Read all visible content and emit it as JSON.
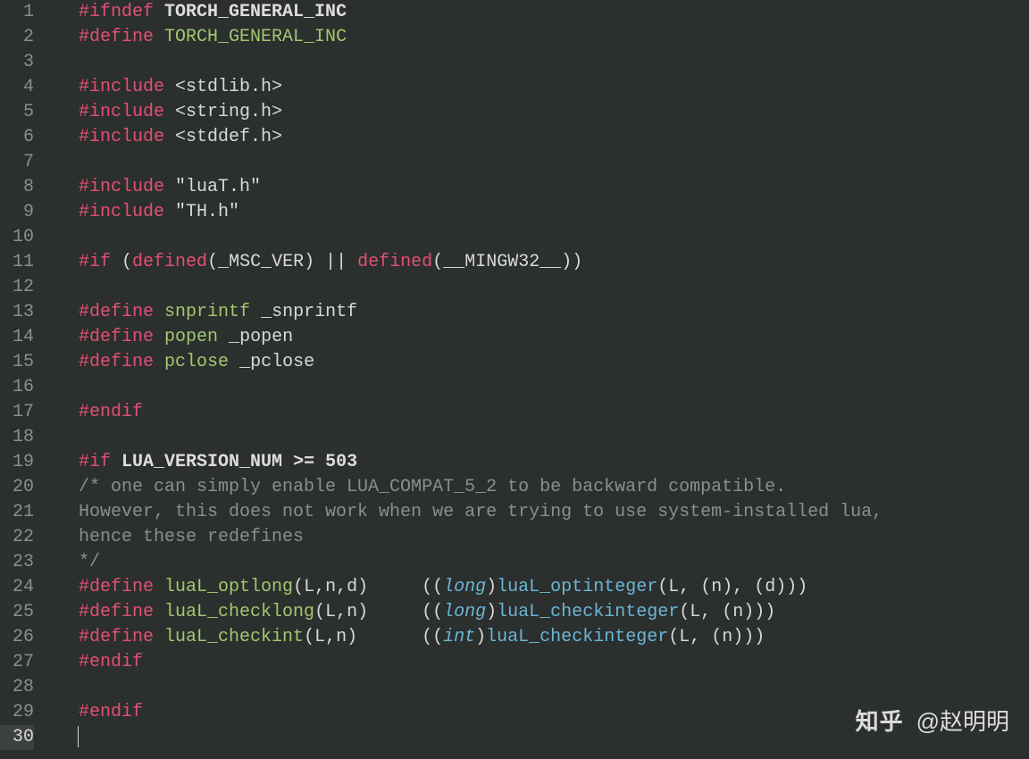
{
  "total_lines": 30,
  "active_line": 30,
  "watermark": {
    "site": "知乎",
    "author": "@赵明明"
  },
  "code_lines": [
    {
      "n": 1,
      "segments": [
        {
          "cls": "c-directive",
          "t": "#ifndef"
        },
        {
          "cls": "c-text",
          "t": " "
        },
        {
          "cls": "c-macro",
          "t": "TORCH_GENERAL_INC"
        }
      ]
    },
    {
      "n": 2,
      "segments": [
        {
          "cls": "c-directive",
          "t": "#define"
        },
        {
          "cls": "c-text",
          "t": " "
        },
        {
          "cls": "c-ident",
          "t": "TORCH_GENERAL_INC"
        }
      ]
    },
    {
      "n": 3,
      "segments": []
    },
    {
      "n": 4,
      "segments": [
        {
          "cls": "c-directive",
          "t": "#include"
        },
        {
          "cls": "c-text",
          "t": " "
        },
        {
          "cls": "c-string",
          "t": "<stdlib.h>"
        }
      ]
    },
    {
      "n": 5,
      "segments": [
        {
          "cls": "c-directive",
          "t": "#include"
        },
        {
          "cls": "c-text",
          "t": " "
        },
        {
          "cls": "c-string",
          "t": "<string.h>"
        }
      ]
    },
    {
      "n": 6,
      "segments": [
        {
          "cls": "c-directive",
          "t": "#include"
        },
        {
          "cls": "c-text",
          "t": " "
        },
        {
          "cls": "c-string",
          "t": "<stddef.h>"
        }
      ]
    },
    {
      "n": 7,
      "segments": []
    },
    {
      "n": 8,
      "segments": [
        {
          "cls": "c-directive",
          "t": "#include"
        },
        {
          "cls": "c-text",
          "t": " "
        },
        {
          "cls": "c-string",
          "t": "\"luaT.h\""
        }
      ]
    },
    {
      "n": 9,
      "segments": [
        {
          "cls": "c-directive",
          "t": "#include"
        },
        {
          "cls": "c-text",
          "t": " "
        },
        {
          "cls": "c-string",
          "t": "\"TH.h\""
        }
      ]
    },
    {
      "n": 10,
      "segments": []
    },
    {
      "n": 11,
      "segments": [
        {
          "cls": "c-directive",
          "t": "#if"
        },
        {
          "cls": "c-text",
          "t": " "
        },
        {
          "cls": "c-punct",
          "t": "("
        },
        {
          "cls": "c-definedkw",
          "t": "defined"
        },
        {
          "cls": "c-punct",
          "t": "("
        },
        {
          "cls": "c-text",
          "t": "_MSC_VER"
        },
        {
          "cls": "c-punct",
          "t": ")"
        },
        {
          "cls": "c-text",
          "t": " "
        },
        {
          "cls": "c-punct",
          "t": "||"
        },
        {
          "cls": "c-text",
          "t": " "
        },
        {
          "cls": "c-definedkw",
          "t": "defined"
        },
        {
          "cls": "c-punct",
          "t": "("
        },
        {
          "cls": "c-text",
          "t": "__MINGW32__"
        },
        {
          "cls": "c-punct",
          "t": "))"
        }
      ]
    },
    {
      "n": 12,
      "segments": []
    },
    {
      "n": 13,
      "segments": [
        {
          "cls": "c-directive",
          "t": "#define"
        },
        {
          "cls": "c-text",
          "t": " "
        },
        {
          "cls": "c-ident",
          "t": "snprintf"
        },
        {
          "cls": "c-text",
          "t": " "
        },
        {
          "cls": "c-ident2",
          "t": "_snprintf"
        }
      ]
    },
    {
      "n": 14,
      "segments": [
        {
          "cls": "c-directive",
          "t": "#define"
        },
        {
          "cls": "c-text",
          "t": " "
        },
        {
          "cls": "c-ident",
          "t": "popen"
        },
        {
          "cls": "c-text",
          "t": " "
        },
        {
          "cls": "c-ident2",
          "t": "_popen"
        }
      ]
    },
    {
      "n": 15,
      "segments": [
        {
          "cls": "c-directive",
          "t": "#define"
        },
        {
          "cls": "c-text",
          "t": " "
        },
        {
          "cls": "c-ident",
          "t": "pclose"
        },
        {
          "cls": "c-text",
          "t": " "
        },
        {
          "cls": "c-ident2",
          "t": "_pclose"
        }
      ]
    },
    {
      "n": 16,
      "segments": []
    },
    {
      "n": 17,
      "segments": [
        {
          "cls": "c-directive",
          "t": "#endif"
        }
      ]
    },
    {
      "n": 18,
      "segments": []
    },
    {
      "n": 19,
      "segments": [
        {
          "cls": "c-directive",
          "t": "#if"
        },
        {
          "cls": "c-text",
          "t": " "
        },
        {
          "cls": "c-macro",
          "t": "LUA_VERSION_NUM >= 503"
        }
      ]
    },
    {
      "n": 20,
      "segments": [
        {
          "cls": "c-comment",
          "t": "/* one can simply enable LUA_COMPAT_5_2 to be backward compatible."
        }
      ]
    },
    {
      "n": 21,
      "segments": [
        {
          "cls": "c-comment",
          "t": "However, this does not work when we are trying to use system-installed lua,"
        }
      ]
    },
    {
      "n": 22,
      "segments": [
        {
          "cls": "c-comment",
          "t": "hence these redefines"
        }
      ]
    },
    {
      "n": 23,
      "segments": [
        {
          "cls": "c-comment",
          "t": "*/"
        }
      ]
    },
    {
      "n": 24,
      "segments": [
        {
          "cls": "c-directive",
          "t": "#define"
        },
        {
          "cls": "c-text",
          "t": " "
        },
        {
          "cls": "c-ident",
          "t": "luaL_optlong"
        },
        {
          "cls": "c-punct",
          "t": "("
        },
        {
          "cls": "c-text",
          "t": "L,n,d"
        },
        {
          "cls": "c-punct",
          "t": ")"
        },
        {
          "cls": "c-text",
          "t": "     "
        },
        {
          "cls": "c-punct",
          "t": "(("
        },
        {
          "cls": "c-definedkw-it",
          "t": "long"
        },
        {
          "cls": "c-punct",
          "t": ")"
        },
        {
          "cls": "c-func",
          "t": "luaL_optinteger"
        },
        {
          "cls": "c-punct",
          "t": "("
        },
        {
          "cls": "c-text",
          "t": "L, (n), (d)"
        },
        {
          "cls": "c-punct",
          "t": "))"
        }
      ]
    },
    {
      "n": 25,
      "segments": [
        {
          "cls": "c-directive",
          "t": "#define"
        },
        {
          "cls": "c-text",
          "t": " "
        },
        {
          "cls": "c-ident",
          "t": "luaL_checklong"
        },
        {
          "cls": "c-punct",
          "t": "("
        },
        {
          "cls": "c-text",
          "t": "L,n"
        },
        {
          "cls": "c-punct",
          "t": ")"
        },
        {
          "cls": "c-text",
          "t": "     "
        },
        {
          "cls": "c-punct",
          "t": "(("
        },
        {
          "cls": "c-definedkw-it",
          "t": "long"
        },
        {
          "cls": "c-punct",
          "t": ")"
        },
        {
          "cls": "c-func",
          "t": "luaL_checkinteger"
        },
        {
          "cls": "c-punct",
          "t": "("
        },
        {
          "cls": "c-text",
          "t": "L, (n)"
        },
        {
          "cls": "c-punct",
          "t": "))"
        }
      ]
    },
    {
      "n": 26,
      "segments": [
        {
          "cls": "c-directive",
          "t": "#define"
        },
        {
          "cls": "c-text",
          "t": " "
        },
        {
          "cls": "c-ident",
          "t": "luaL_checkint"
        },
        {
          "cls": "c-punct",
          "t": "("
        },
        {
          "cls": "c-text",
          "t": "L,n"
        },
        {
          "cls": "c-punct",
          "t": ")"
        },
        {
          "cls": "c-text",
          "t": "      "
        },
        {
          "cls": "c-punct",
          "t": "(("
        },
        {
          "cls": "c-definedkw-it",
          "t": "int"
        },
        {
          "cls": "c-punct",
          "t": ")"
        },
        {
          "cls": "c-func",
          "t": "luaL_checkinteger"
        },
        {
          "cls": "c-punct",
          "t": "("
        },
        {
          "cls": "c-text",
          "t": "L, (n)"
        },
        {
          "cls": "c-punct",
          "t": "))"
        }
      ]
    },
    {
      "n": 27,
      "segments": [
        {
          "cls": "c-directive",
          "t": "#endif"
        }
      ]
    },
    {
      "n": 28,
      "segments": []
    },
    {
      "n": 29,
      "segments": [
        {
          "cls": "c-directive",
          "t": "#endif"
        }
      ]
    },
    {
      "n": 30,
      "segments": []
    }
  ]
}
